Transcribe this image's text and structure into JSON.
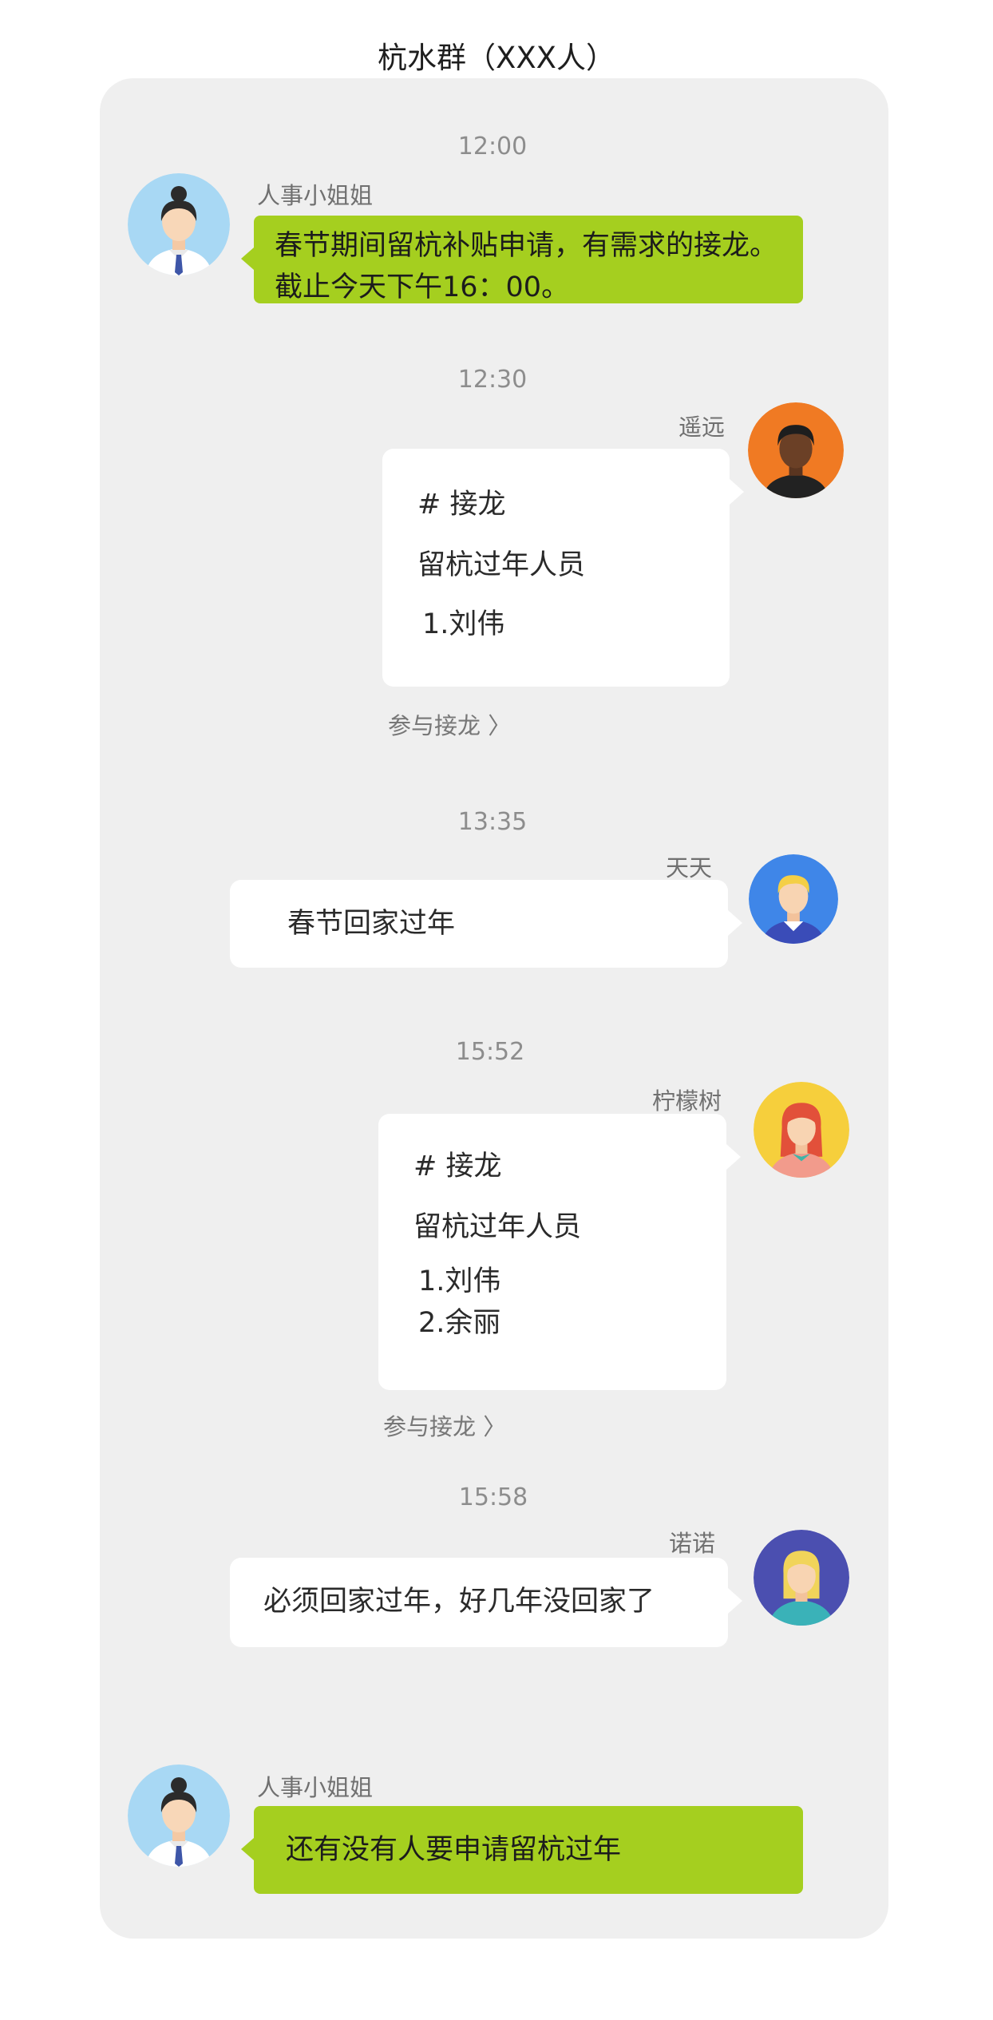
{
  "header": {
    "title": "杭水群（XXX人）"
  },
  "messages": [
    {
      "time": "12:00",
      "sender": "人事小姐姐",
      "lines": [
        "春节期间留杭补贴申请，有需求的接龙。",
        "截止今天下午16：00。"
      ]
    },
    {
      "time": "12:30",
      "sender": "遥远",
      "heading": "# 接龙",
      "subtitle": "留杭过年人员",
      "entries": [
        "1.刘伟"
      ],
      "join_label": "参与接龙 〉"
    },
    {
      "time": "13:35",
      "sender": "天天",
      "lines": [
        "春节回家过年"
      ]
    },
    {
      "time": "15:52",
      "sender": "柠檬树",
      "heading": "# 接龙",
      "subtitle": "留杭过年人员",
      "entries": [
        "1.刘伟",
        "2.余丽"
      ],
      "join_label": "参与接龙 〉"
    },
    {
      "time": "15:58",
      "sender": "诺诺",
      "lines": [
        "必须回家过年，好几年没回家了"
      ]
    },
    {
      "sender": "人事小姐姐",
      "lines": [
        "还有没有人要申请留杭过年"
      ]
    }
  ],
  "colors": {
    "green_bubble": "#a5cf1f",
    "panel": "#efefef",
    "white_bubble": "#ffffff"
  },
  "icons": [
    "hr-woman-avatar",
    "dark-man-avatar",
    "blond-man-avatar",
    "redhair-woman-avatar",
    "blond-woman-avatar"
  ]
}
